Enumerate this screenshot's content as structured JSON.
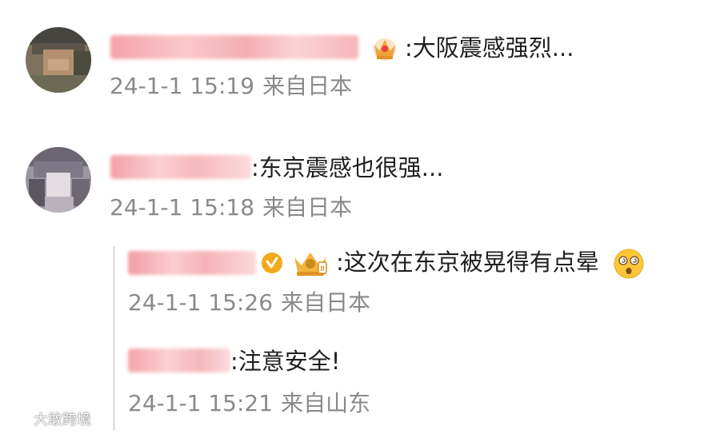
{
  "comments": [
    {
      "text": ":大阪震感强烈...",
      "time": "24-1-1 15:19",
      "location": "来自日本",
      "badge_icon": "crown-badge-icon"
    },
    {
      "text": ":东京震感也很强...",
      "time": "24-1-1 15:18",
      "location": "来自日本",
      "replies": [
        {
          "text": ":这次在东京被晃得有点晕",
          "emoji": "dizzy-face-emoji",
          "time": "24-1-1 15:26",
          "location": "来自日本",
          "badge_icons": [
            "verified-v-icon",
            "gold-crown-badge-icon"
          ]
        },
        {
          "text": ":注意安全!",
          "time": "24-1-1 15:21",
          "location": "来自山东"
        }
      ]
    }
  ],
  "watermark": {
    "text": "大敢跨境",
    "logo_icon": "watermark-logo-icon"
  },
  "colors": {
    "text": "#1f1f1f",
    "meta": "#8a8a8a",
    "verified": "#f2a91a",
    "crown": "#f0a23a",
    "blurred_name": "#f6b0b4"
  }
}
